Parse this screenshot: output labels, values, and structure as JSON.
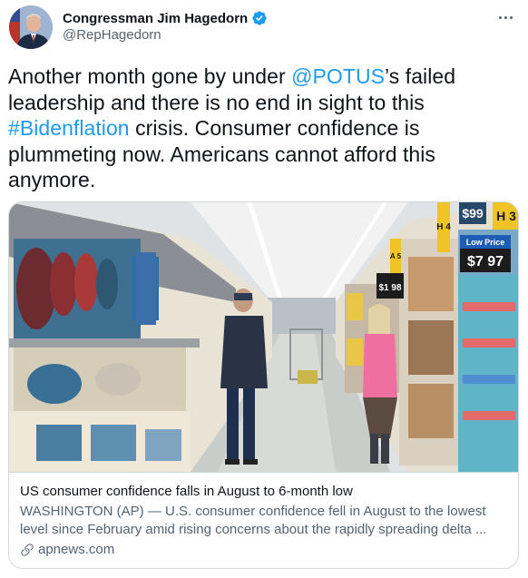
{
  "tweet": {
    "author_name": "Congressman Jim Hagedorn",
    "author_handle": "@RepHagedorn",
    "text_part1": "Another month gone by under ",
    "mention": "@POTUS",
    "text_part2": "’s failed leadership and there is no end in sight to this ",
    "hashtag": "#Bidenflation",
    "text_part3": " crisis. Consumer confidence is plummeting now.  Americans cannot afford this anymore."
  },
  "card": {
    "title": "US consumer confidence falls in August to 6-month low",
    "description": "WASHINGTON (AP) — U.S. consumer confidence fell in August to the lowest level since February amid rising concerns about the rapidly spreading delta ...",
    "domain": "apnews.com",
    "image": {
      "price_tag_1": "$1 98",
      "price_tag_2": "$7 97",
      "low_price": "Low Price",
      "aisle_1": "H 3",
      "aisle_2": "H 4",
      "aisle_3": "A 5",
      "price_top": "$99"
    }
  },
  "icons": {
    "verified": "verified-badge-icon",
    "more": "more-options-icon",
    "link": "link-icon"
  },
  "colors": {
    "accent": "#1d9bf0",
    "text": "#0f1419",
    "muted": "#536471",
    "border": "#cfd9de"
  }
}
